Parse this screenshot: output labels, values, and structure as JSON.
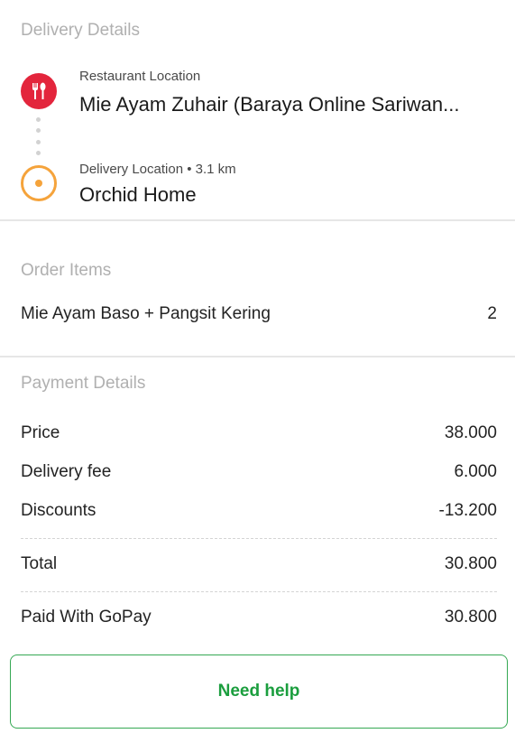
{
  "delivery": {
    "section_title": "Delivery Details",
    "restaurant_label": "Restaurant Location",
    "restaurant_name": "Mie Ayam Zuhair (Baraya Online Sariwan...",
    "delivery_label": "Delivery Location • 3.1 km",
    "delivery_name": "Orchid Home",
    "restaurant_icon": "fork-knife-icon",
    "delivery_icon": "location-pin-icon",
    "colors": {
      "restaurant": "#e3253c",
      "delivery": "#f5a33b"
    }
  },
  "order": {
    "section_title": "Order Items",
    "items": [
      {
        "name": "Mie Ayam Baso + Pangsit Kering",
        "qty": "2"
      }
    ]
  },
  "payment": {
    "section_title": "Payment Details",
    "rows": [
      {
        "label": "Price",
        "value": "38.000"
      },
      {
        "label": "Delivery fee",
        "value": "6.000"
      },
      {
        "label": "Discounts",
        "value": "-13.200"
      }
    ],
    "total": {
      "label": "Total",
      "value": "30.800"
    },
    "paid": {
      "label": "Paid With GoPay",
      "value": "30.800"
    }
  },
  "help_button": {
    "label": "Need help",
    "color": "#1b9e3e"
  }
}
